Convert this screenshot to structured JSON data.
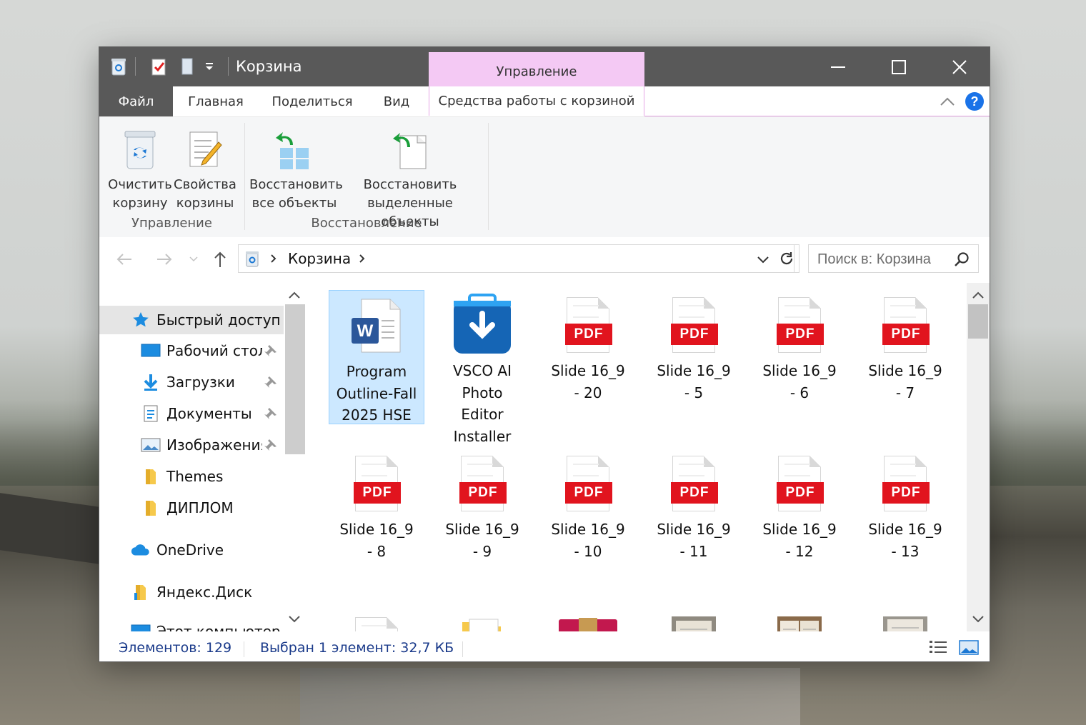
{
  "window": {
    "title": "Корзина",
    "context_tab": "Управление"
  },
  "tabs": {
    "file": "Файл",
    "home": "Главная",
    "share": "Поделиться",
    "view": "Вид",
    "tools": "Средства работы с корзиной"
  },
  "ribbon": {
    "empty_l1": "Очистить",
    "empty_l2": "корзину",
    "props_l1": "Свойства",
    "props_l2": "корзины",
    "restore_all_l1": "Восстановить",
    "restore_all_l2": "все объекты",
    "restore_sel_l1": "Восстановить",
    "restore_sel_l2": "выделенные объекты",
    "group_manage": "Управление",
    "group_restore": "Восстановление"
  },
  "address": {
    "path": "Корзина",
    "search_placeholder": "Поиск в: Корзина"
  },
  "nav": {
    "quick_access": "Быстрый доступ",
    "desktop": "Рабочий стол",
    "downloads": "Загрузки",
    "documents": "Документы",
    "pictures": "Изображения",
    "themes": "Themes",
    "diploma": "ДИПЛОМ",
    "onedrive": "OneDrive",
    "yandex": "Яндекс.Диск",
    "this_pc": "Этот компьютер"
  },
  "files": [
    {
      "l1": "Program",
      "l2": "Outline-Fall",
      "l3": "2025 HSE",
      "l4": ""
    },
    {
      "l1": "VSCO AI",
      "l2": "Photo",
      "l3": "Editor",
      "l4": "Installer"
    },
    {
      "l1": "Slide 16_9",
      "l2": "- 20",
      "l3": "",
      "l4": ""
    },
    {
      "l1": "Slide 16_9",
      "l2": "- 5",
      "l3": "",
      "l4": ""
    },
    {
      "l1": "Slide 16_9",
      "l2": "- 6",
      "l3": "",
      "l4": ""
    },
    {
      "l1": "Slide 16_9",
      "l2": "- 7",
      "l3": "",
      "l4": ""
    },
    {
      "l1": "Slide 16_9",
      "l2": "- 8",
      "l3": "",
      "l4": ""
    },
    {
      "l1": "Slide 16_9",
      "l2": "- 9",
      "l3": "",
      "l4": ""
    },
    {
      "l1": "Slide 16_9",
      "l2": "- 10",
      "l3": "",
      "l4": ""
    },
    {
      "l1": "Slide 16_9",
      "l2": "- 11",
      "l3": "",
      "l4": ""
    },
    {
      "l1": "Slide 16_9",
      "l2": "- 12",
      "l3": "",
      "l4": ""
    },
    {
      "l1": "Slide 16_9",
      "l2": "- 13",
      "l3": "",
      "l4": ""
    }
  ],
  "pdf_label": "PDF",
  "status": {
    "count": "Элементов: 129",
    "selection": "Выбран 1 элемент: 32,7 КБ"
  },
  "colors": {
    "titlebar": "#595959",
    "context_tab": "#f4c9f4",
    "selection": "#cce8ff",
    "pdf_red": "#e1141e",
    "word_blue": "#2b579a",
    "help_blue": "#1a73e8"
  },
  "icons": [
    "recycle-bin-icon",
    "properties-icon",
    "restore-all-icon",
    "restore-selected-icon",
    "word-file-icon",
    "vsco-installer-icon",
    "pdf-file-icon",
    "folder-pdf-icon",
    "winrar-archive-icon",
    "photo-thumbnail"
  ]
}
